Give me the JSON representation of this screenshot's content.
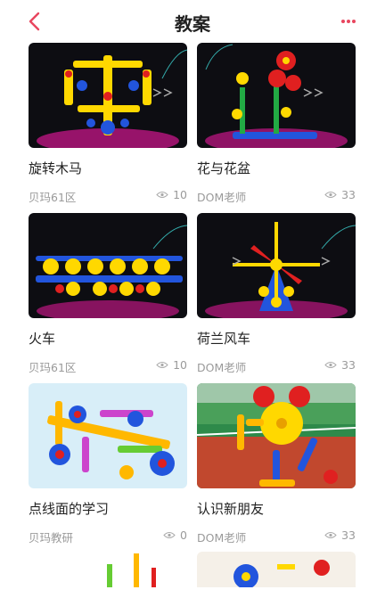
{
  "header": {
    "title": "教案",
    "back_icon": "chevron-left-icon",
    "more_icon": "more-dots-icon",
    "accent": "#e8465e"
  },
  "cards": [
    {
      "title": "旋转木马",
      "author": "贝玛61区",
      "views": "10",
      "thumb": "dark-robot-model"
    },
    {
      "title": "花与花盆",
      "author": "DOM老师",
      "views": "33",
      "thumb": "dark-flower-model"
    },
    {
      "title": "火车",
      "author": "贝玛61区",
      "views": "10",
      "thumb": "dark-train-model"
    },
    {
      "title": "荷兰风车",
      "author": "DOM老师",
      "views": "33",
      "thumb": "dark-windmill-model"
    },
    {
      "title": "点线面的学习",
      "author": "贝玛教研",
      "views": "0",
      "thumb": "light-car-model"
    },
    {
      "title": "认识新朋友",
      "author": "DOM老师",
      "views": "33",
      "thumb": "outdoor-robot-photo"
    }
  ]
}
